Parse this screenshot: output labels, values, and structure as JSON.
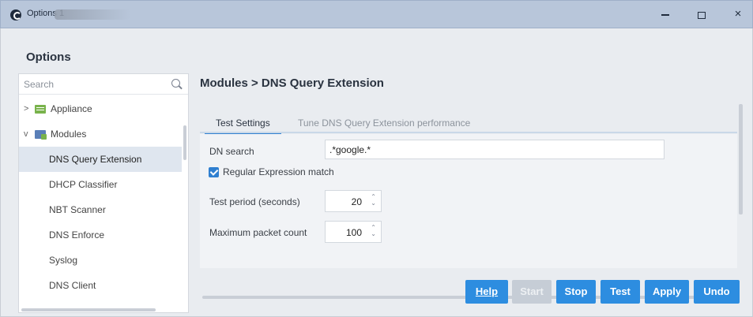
{
  "window": {
    "title": "Options 1",
    "controls": {
      "minimize": "minimize-icon",
      "maximize": "maximize-icon",
      "close": "×"
    }
  },
  "options_heading": "Options",
  "sidebar": {
    "search_placeholder": "Search",
    "tree": {
      "appliance": {
        "label": "Appliance",
        "expanded": false,
        "chevron": ">"
      },
      "modules": {
        "label": "Modules",
        "expanded": true,
        "chevron": "v"
      },
      "children": [
        {
          "label": "DNS Query Extension",
          "selected": true
        },
        {
          "label": "DHCP Classifier"
        },
        {
          "label": "NBT Scanner"
        },
        {
          "label": "DNS Enforce"
        },
        {
          "label": "Syslog"
        },
        {
          "label": "DNS Client"
        }
      ]
    }
  },
  "main": {
    "breadcrumb": "Modules > DNS Query Extension",
    "tabs": [
      {
        "label": "Test Settings",
        "active": true
      },
      {
        "label": "Tune DNS Query Extension performance",
        "active": false
      }
    ],
    "form": {
      "dn_search": {
        "label": "DN search",
        "value": ".*google.*"
      },
      "regex_match": {
        "label": "Regular Expression match",
        "checked": true
      },
      "test_period": {
        "label": "Test period (seconds)",
        "value": "20"
      },
      "max_packets": {
        "label": "Maximum packet count",
        "value": "100"
      }
    },
    "buttons": {
      "help": "Help",
      "start": "Start",
      "stop": "Stop",
      "test": "Test",
      "apply": "Apply",
      "undo": "Undo"
    }
  },
  "colors": {
    "titlebar": "#b8c6da",
    "accent": "#2d8de0",
    "disabled": "#c6cdd6",
    "selected_row": "#dfe6ef"
  }
}
